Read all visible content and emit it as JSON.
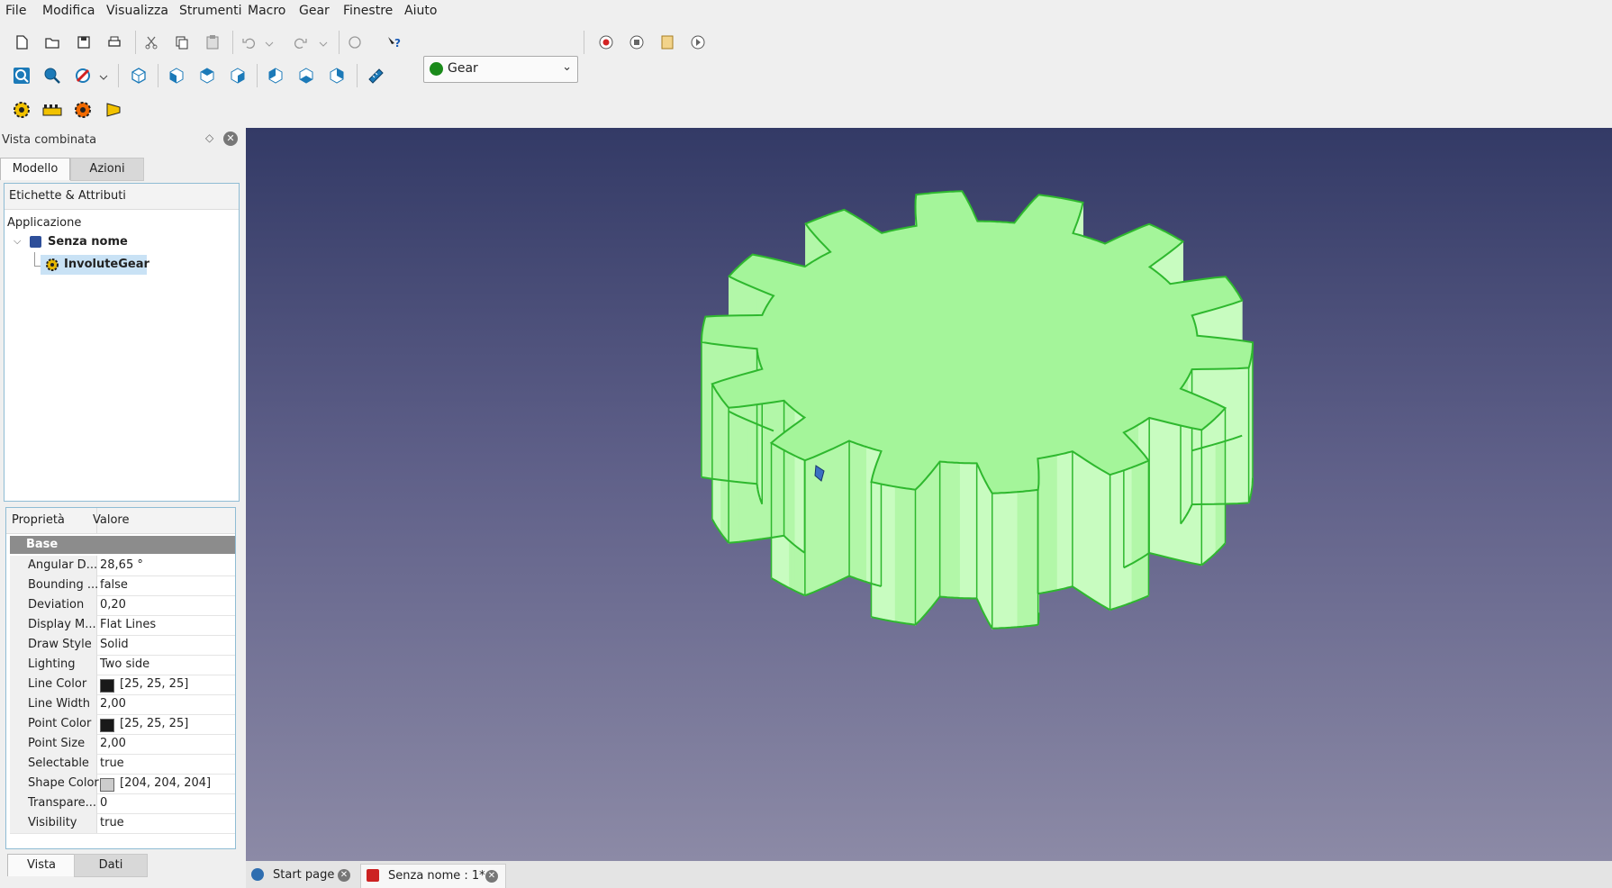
{
  "menu": [
    "File",
    "Modifica",
    "Visualizza",
    "Strumenti",
    "Macro",
    "Gear",
    "Finestre",
    "Aiuto"
  ],
  "workbench": {
    "selected": "Gear"
  },
  "panel": {
    "title": "Vista combinata",
    "tabs": [
      "Modello",
      "Azioni"
    ],
    "tree": {
      "header": "Etichette & Attributi",
      "root": "Applicazione",
      "document": "Senza nome",
      "object": "InvoluteGear"
    },
    "properties": {
      "col_name": "Proprietà",
      "col_value": "Valore",
      "group": "Base",
      "rows": [
        {
          "name": "Angular D...",
          "value": "28,65 °"
        },
        {
          "name": "Bounding ...",
          "value": "false"
        },
        {
          "name": "Deviation",
          "value": "0,20"
        },
        {
          "name": "Display M...",
          "value": "Flat Lines"
        },
        {
          "name": "Draw Style",
          "value": "Solid"
        },
        {
          "name": "Lighting",
          "value": "Two side"
        },
        {
          "name": "Line Color",
          "value": "[25, 25, 25]",
          "swatch": "#191919"
        },
        {
          "name": "Line Width",
          "value": "2,00"
        },
        {
          "name": "Point Color",
          "value": "[25, 25, 25]",
          "swatch": "#191919"
        },
        {
          "name": "Point Size",
          "value": "2,00"
        },
        {
          "name": "Selectable",
          "value": "true"
        },
        {
          "name": "Shape Color",
          "value": "[204, 204, 204]",
          "swatch": "#cccccc"
        },
        {
          "name": "Transpare...",
          "value": "0"
        },
        {
          "name": "Visibility",
          "value": "true"
        }
      ]
    },
    "bottom_tabs": [
      "Vista",
      "Dati"
    ]
  },
  "doc_tabs": [
    "Start page",
    "Senza nome : 1*"
  ],
  "colors": {
    "gear_face": "#a4f59a",
    "gear_side": "#c8fcc0",
    "gear_edge": "#2eb82e"
  }
}
